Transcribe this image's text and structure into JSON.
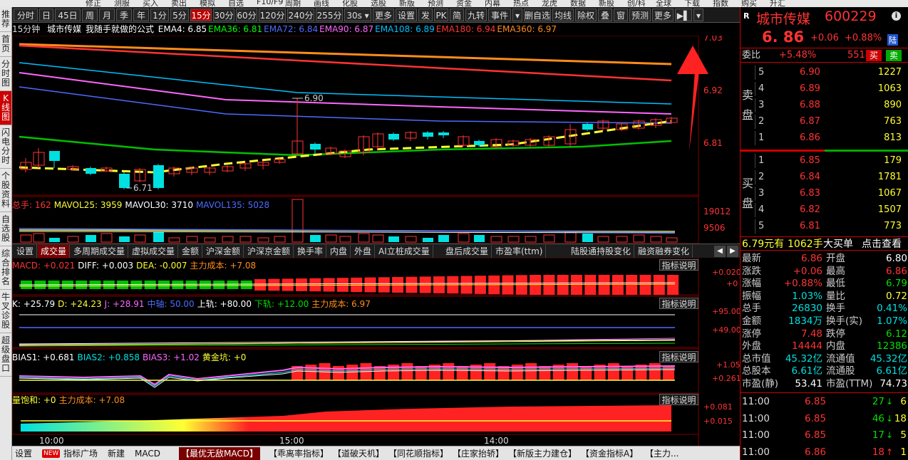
{
  "top_menu": [
    "修正",
    "测服",
    "买入",
    "卖出",
    "模拟",
    "自选",
    "F10/F9",
    "周期",
    "画线",
    "化股",
    "选股",
    "新版",
    "预测",
    "资金",
    "内幕",
    "热点",
    "龙虎",
    "数据",
    "新股",
    "创/科",
    "全球",
    "下载",
    "指数",
    "购买",
    "升汇"
  ],
  "left_nav": [
    {
      "label": "推荐"
    },
    {
      "label": "首页"
    },
    {
      "label": "分时图"
    },
    {
      "label": "K线图",
      "active": true
    },
    {
      "label": "闪电分时"
    },
    {
      "label": "个股资料"
    },
    {
      "label": "自选股"
    },
    {
      "label": "综合排名"
    },
    {
      "label": "牛叉诊股"
    },
    {
      "label": "超级盘口"
    }
  ],
  "toolbar": {
    "items": [
      {
        "label": "分时"
      },
      {
        "label": "日"
      },
      {
        "label": "45日"
      },
      {
        "label": "周"
      },
      {
        "label": "月"
      },
      {
        "label": "季"
      },
      {
        "label": "年"
      },
      {
        "label": "1分"
      },
      {
        "label": "5分"
      },
      {
        "label": "15分",
        "active": true
      },
      {
        "label": "30分"
      },
      {
        "label": "60分"
      },
      {
        "label": "120分"
      },
      {
        "label": "240分"
      },
      {
        "label": "255分"
      },
      {
        "label": "30s ▾"
      },
      {
        "label": "更多"
      },
      {
        "label": "设置"
      },
      {
        "label": "发"
      },
      {
        "label": "PK"
      },
      {
        "label": "简"
      },
      {
        "label": "九转"
      },
      {
        "label": "事件"
      },
      {
        "label": "▾"
      },
      {
        "label": "删自选"
      },
      {
        "label": "均线"
      },
      {
        "label": "除权"
      },
      {
        "label": "叠"
      },
      {
        "label": "窗"
      },
      {
        "label": "预测"
      },
      {
        "label": "更多"
      },
      {
        "label": "▶▌"
      },
      {
        "label": "▾"
      }
    ]
  },
  "info_bar": {
    "period": "15分钟",
    "name": "城市传媒",
    "formula": "我随手就做的公式",
    "ema": [
      {
        "label": "EMA4: 6.85",
        "color": "#ffffff"
      },
      {
        "label": "EMA36: 6.81",
        "color": "#00ff00"
      },
      {
        "label": "EMA72: 6.84",
        "color": "#4d6bff"
      },
      {
        "label": "EMA90: 6.87",
        "color": "#ff66ff"
      },
      {
        "label": "EMA108: 6.89",
        "color": "#00c0ff"
      },
      {
        "label": "EMA180: 6.94",
        "color": "#ff3333"
      },
      {
        "label": "EMA360: 6.97",
        "color": "#ff8c1a"
      }
    ]
  },
  "main_chart": {
    "price_axis": [
      "7.03",
      "6.92",
      "6.81"
    ],
    "max_label": "6.90",
    "min_label": "6.71"
  },
  "volume": {
    "labels": [
      {
        "text": "总手: 162",
        "color": "#ff3333"
      },
      {
        "text": "MAVOL25: 3959",
        "color": "#ffff33"
      },
      {
        "text": "MAVOL30: 3710",
        "color": "#ffffff"
      },
      {
        "text": "MAVOL135: 5028",
        "color": "#4d6bff"
      }
    ],
    "axis": [
      "19012",
      "9506"
    ]
  },
  "indicator_tabs": [
    {
      "label": "设置"
    },
    {
      "label": "成交量",
      "active": true
    },
    {
      "label": "多周期成交量"
    },
    {
      "label": "虚拟成交量"
    },
    {
      "label": "金额"
    },
    {
      "label": "沪深金额"
    },
    {
      "label": "沪深京金额"
    },
    {
      "label": "换手率"
    },
    {
      "label": "内盘"
    },
    {
      "label": "外盘"
    },
    {
      "label": "AI立桩成交量"
    },
    {
      "label": "盘后成交量"
    },
    {
      "label": "市盈率(ttm)"
    },
    {
      "label": "陆股通持股变化"
    },
    {
      "label": "融资融券变化"
    }
  ],
  "macd": {
    "labels": [
      {
        "text": "MACD: +0.021",
        "color": "#ff3333"
      },
      {
        "text": "DIFF: +0.003",
        "color": "#ffffff"
      },
      {
        "text": "DEA: -0.007",
        "color": "#ffff33"
      },
      {
        "text": "主力成本: +7.08",
        "color": "#ff8c1a"
      }
    ],
    "axis": [
      "+0.020",
      "+0"
    ]
  },
  "kdj": {
    "labels": [
      {
        "text": "K: +25.79",
        "color": "#ffffff"
      },
      {
        "text": "D: +24.23",
        "color": "#ffff33"
      },
      {
        "text": "J: +28.91",
        "color": "#ff66ff"
      },
      {
        "text": "中轴: 50.00",
        "color": "#4d6bff"
      },
      {
        "text": "上轨: +80.00",
        "color": "#ffffff"
      },
      {
        "text": "下轨: +12.00",
        "color": "#00e000"
      },
      {
        "text": "主力成本: 6.97",
        "color": "#ff8c1a"
      }
    ],
    "axis": [
      "+95.00",
      "+49.00"
    ]
  },
  "bias": {
    "labels": [
      {
        "text": "BIAS1: +0.681",
        "color": "#ffffff"
      },
      {
        "text": "BIAS2: +0.858",
        "color": "#00e0e0"
      },
      {
        "text": "BIAS3: +1.02",
        "color": "#ff66ff"
      },
      {
        "text": "黄金坑: +0",
        "color": "#ffff33"
      }
    ],
    "axis": [
      "+1.05",
      "+0.261"
    ]
  },
  "satur": {
    "labels": [
      {
        "text": "量饱和: +0",
        "color": "#ffff33"
      },
      {
        "text": "主力成本: +7.08",
        "color": "#ff8c1a"
      }
    ],
    "axis": [
      "+0.081",
      "+0.015"
    ]
  },
  "explain_label": "指标说明",
  "time_axis": [
    "10:00",
    "15:00",
    "14:00"
  ],
  "bottom_tabs": [
    "设置",
    "NEW",
    "指标广场",
    "新建",
    "MACD",
    "【最优无敌MACD】",
    "【乖离率指标】",
    "【道破天机】",
    "【同花顺指标】",
    "【庄家抬轿】",
    "【新版主力建仓】",
    "【资金指标A】",
    "【主力..."
  ],
  "right_panel": {
    "code_badge": "R",
    "name": "城市传媒",
    "code": "600229",
    "price": "6. 86",
    "change": "+0.06",
    "pct": "+0.88%",
    "market_badge": "陆",
    "weibi_label": "委比",
    "weibi_value": "+5.48%",
    "weicha": "551",
    "sell_btn": "买",
    "buy_btn": "卖",
    "sell_label": "卖盘",
    "buy_label": "买盘",
    "asks": [
      {
        "level": "5",
        "price": "6.90",
        "vol": "1227"
      },
      {
        "level": "4",
        "price": "6.89",
        "vol": "1063"
      },
      {
        "level": "3",
        "price": "6.88",
        "vol": "890"
      },
      {
        "level": "2",
        "price": "6.87",
        "vol": "763"
      },
      {
        "level": "1",
        "price": "6.86",
        "vol": "813"
      }
    ],
    "bids": [
      {
        "level": "1",
        "price": "6.85",
        "vol": "179"
      },
      {
        "level": "2",
        "price": "6.84",
        "vol": "1781"
      },
      {
        "level": "3",
        "price": "6.83",
        "vol": "1067"
      },
      {
        "level": "4",
        "price": "6.82",
        "vol": "1507"
      },
      {
        "level": "5",
        "price": "6.81",
        "vol": "773"
      }
    ],
    "bigorder": {
      "a": "6.79元有",
      "b": "1062手",
      "c": "大买单",
      "d": "点击查看"
    },
    "stats": [
      {
        "l1": "最新",
        "v1": "6.86",
        "c1": "red",
        "l2": "开盘",
        "v2": "6.80",
        "c2": "wht"
      },
      {
        "l1": "涨跌",
        "v1": "+0.06",
        "c1": "red",
        "l2": "最高",
        "v2": "6.86",
        "c2": "red"
      },
      {
        "l1": "涨幅",
        "v1": "+0.88%",
        "c1": "red",
        "l2": "最低",
        "v2": "6.79",
        "c2": "grn"
      },
      {
        "l1": "振幅",
        "v1": "1.03%",
        "c1": "cyan",
        "l2": "量比",
        "v2": "0.72",
        "c2": "yel"
      },
      {
        "l1": "总手",
        "v1": "26830",
        "c1": "cyan",
        "l2": "换手",
        "v2": "0.41%",
        "c2": "cyan"
      },
      {
        "l1": "金额",
        "v1": "1834万",
        "c1": "cyan",
        "l2": "换手(实)",
        "v2": "1.07%",
        "c2": "cyan"
      },
      {
        "l1": "涨停",
        "v1": "7.48",
        "c1": "red",
        "l2": "跌停",
        "v2": "6.12",
        "c2": "grn"
      },
      {
        "l1": "外盘",
        "v1": "14444",
        "c1": "red",
        "l2": "内盘",
        "v2": "12386",
        "c2": "grn"
      },
      {
        "l1": "总市值",
        "v1": "45.32亿",
        "c1": "cyan",
        "l2": "流通值",
        "v2": "45.32亿",
        "c2": "cyan"
      },
      {
        "l1": "总股本",
        "v1": "6.61亿",
        "c1": "cyan",
        "l2": "流通股",
        "v2": "6.61亿",
        "c2": "cyan"
      },
      {
        "l1": "市盈(静)",
        "v1": "53.41",
        "c1": "wht",
        "l2": "市盈(TTM)",
        "v2": "74.73",
        "c2": "wht"
      }
    ],
    "ticks": [
      {
        "time": "11:00",
        "price": "6.85",
        "vol": "27",
        "dir": "down",
        "n": "6"
      },
      {
        "time": "11:00",
        "price": "6.85",
        "vol": "46",
        "dir": "down",
        "n": "18"
      },
      {
        "time": "11:00",
        "price": "6.85",
        "vol": "17",
        "dir": "down",
        "n": "5"
      },
      {
        "time": "11:00",
        "price": "6.86",
        "vol": "18",
        "dir": "up",
        "n": "1"
      }
    ]
  },
  "colors": {
    "accent": "#cc0000",
    "up": "#ff3333",
    "down": "#00e000",
    "cyan": "#00e0e0"
  }
}
